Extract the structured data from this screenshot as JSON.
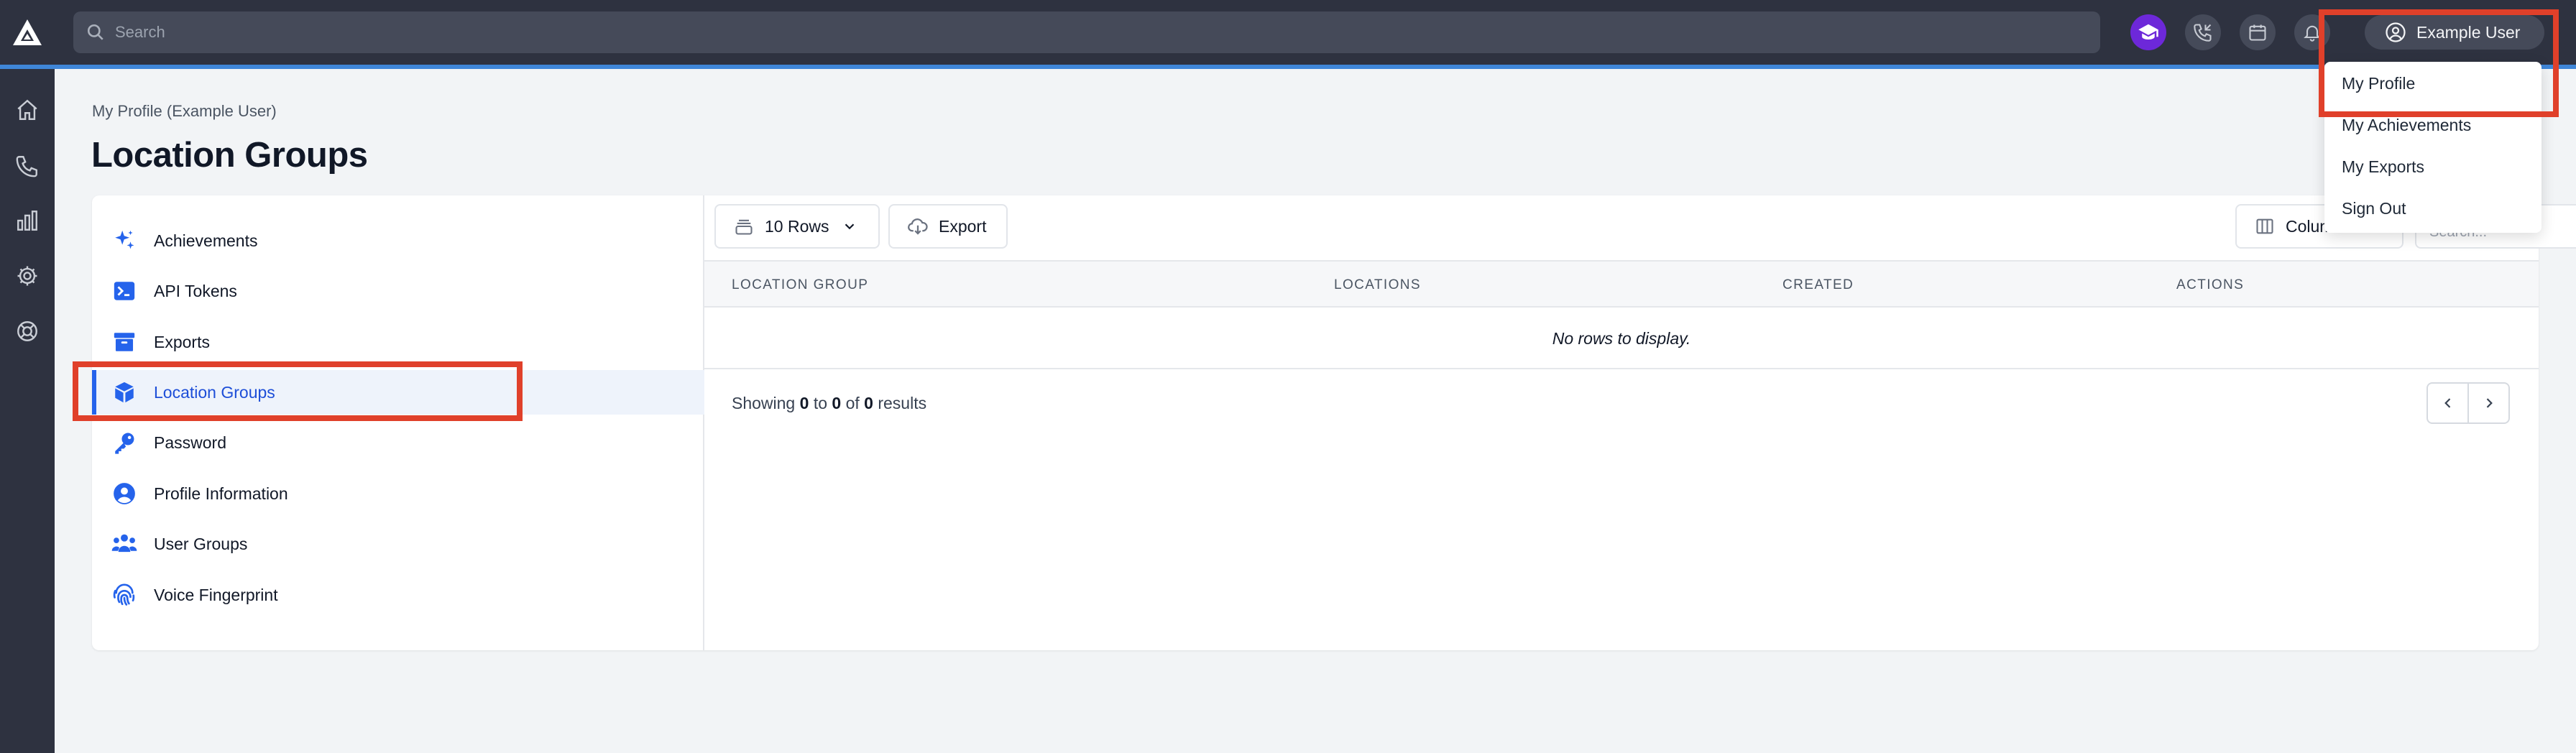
{
  "topbar": {
    "search_placeholder": "Search",
    "user_label": "Example User"
  },
  "header": {
    "breadcrumb": "My Profile (Example User)",
    "title": "Location Groups"
  },
  "sidebar": {
    "items": [
      {
        "label": "Achievements",
        "icon": "sparkles-icon"
      },
      {
        "label": "API Tokens",
        "icon": "terminal-icon"
      },
      {
        "label": "Exports",
        "icon": "archive-box-icon"
      },
      {
        "label": "Location Groups",
        "icon": "cube-icon",
        "active": true
      },
      {
        "label": "Password",
        "icon": "key-icon"
      },
      {
        "label": "Profile Information",
        "icon": "user-circle-icon"
      },
      {
        "label": "User Groups",
        "icon": "user-group-icon"
      },
      {
        "label": "Voice Fingerprint",
        "icon": "fingerprint-icon"
      }
    ]
  },
  "toolbar": {
    "rows_label": "10 Rows",
    "export_label": "Export",
    "columns_label": "Columns"
  },
  "table": {
    "columns": [
      "LOCATION GROUP",
      "LOCATIONS",
      "CREATED",
      "ACTIONS"
    ],
    "empty_message": "No rows to display."
  },
  "pagination": {
    "prefix": "Showing",
    "from": "0",
    "to_word": "to",
    "to": "0",
    "of_word": "of",
    "total": "0",
    "suffix": "results"
  },
  "user_menu": {
    "items": [
      "My Profile",
      "My Achievements",
      "My Exports",
      "Sign Out"
    ]
  },
  "colors": {
    "accent": "#2563eb",
    "topbar": "#2e3240",
    "highlight": "#e0402a"
  }
}
